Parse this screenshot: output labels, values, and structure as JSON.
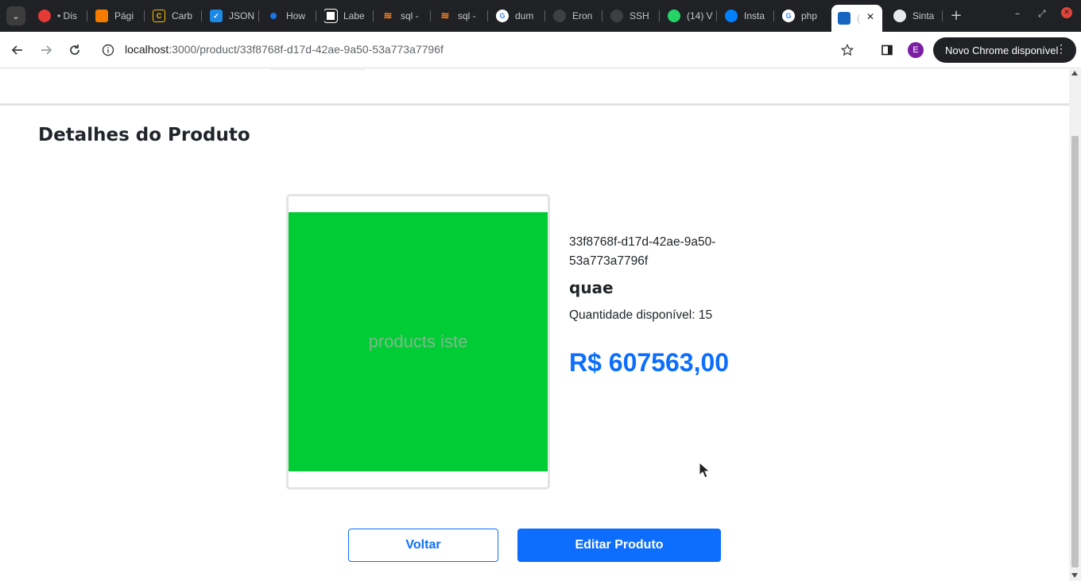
{
  "browser": {
    "tabs": [
      {
        "label": "• Dis",
        "icon": "google-chat-icon",
        "color": "#4285f4"
      },
      {
        "label": "Pági",
        "icon": "blogger-icon",
        "color": "#f57c00"
      },
      {
        "label": "Carb",
        "icon": "carbon-icon",
        "color": "#202124"
      },
      {
        "label": "JSON",
        "icon": "checkbox-icon",
        "color": "#1e88e5"
      },
      {
        "label": "How",
        "icon": "dot-icon",
        "color": "#1a73e8"
      },
      {
        "label": "Labe",
        "icon": "labelbox-icon",
        "color": "#ffffff"
      },
      {
        "label": "sql -",
        "icon": "stackoverflow-icon",
        "color": "#f48024"
      },
      {
        "label": "sql -",
        "icon": "stackoverflow-icon",
        "color": "#f48024"
      },
      {
        "label": "dum",
        "icon": "google-icon",
        "color": "#4285f4"
      },
      {
        "label": "Eron",
        "icon": "github-icon",
        "color": "#444"
      },
      {
        "label": "SSH",
        "icon": "github-icon",
        "color": "#444"
      },
      {
        "label": "(14) V",
        "icon": "whatsapp-icon",
        "color": "#25d366"
      },
      {
        "label": "Insta",
        "icon": "digitalocean-icon",
        "color": "#0080ff"
      },
      {
        "label": "php",
        "icon": "google-icon",
        "color": "#4285f4"
      },
      {
        "label": "(",
        "icon": "app-icon",
        "color": "#1565c0"
      },
      {
        "label": "Sinta",
        "icon": "github-icon",
        "color": "#e8eaed"
      }
    ],
    "url_host": "localhost",
    "url_path": ":3000/product/33f8768f-d17d-42ae-9a50-53a773a7796f",
    "profile_initial": "E",
    "update_label": "Novo Chrome disponível"
  },
  "page": {
    "title": "Detalhes do Produto",
    "image_alt": "products iste",
    "product": {
      "id": "33f8768f-d17d-42ae-9a50-53a773a7796f",
      "name": "quae",
      "quantity_label": "Quantidade disponível: 15",
      "price": "R$ 607563,00"
    },
    "buttons": {
      "back": "Voltar",
      "edit": "Editar Produto"
    }
  },
  "colors": {
    "primary": "#0d6efd",
    "image_bg": "#00cc35"
  }
}
